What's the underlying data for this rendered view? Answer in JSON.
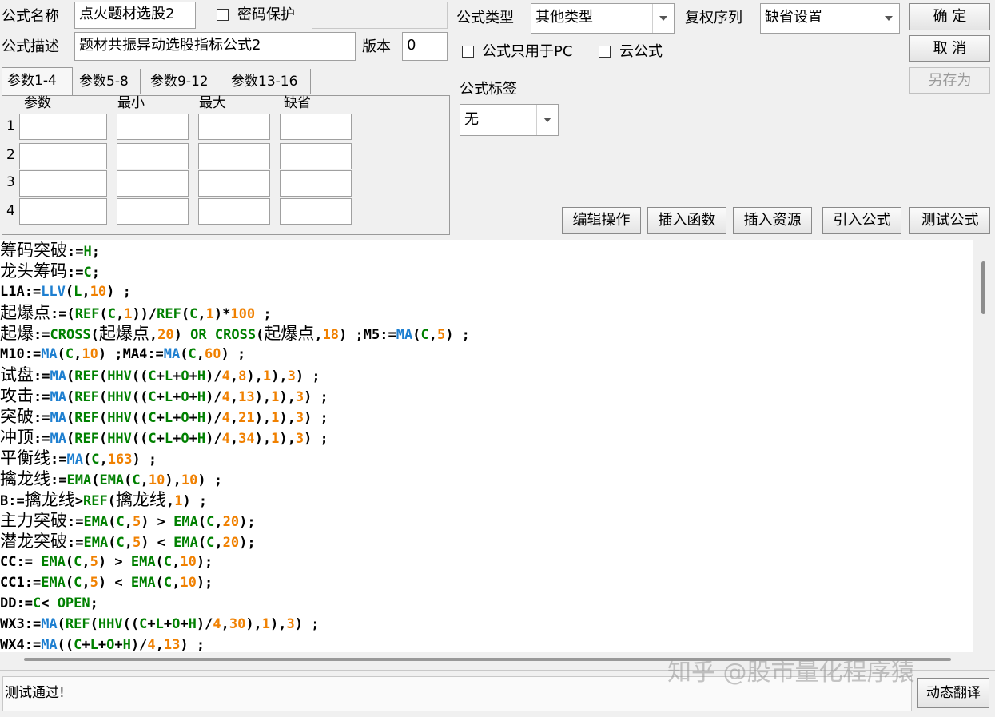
{
  "header": {
    "formula_name_label": "公式名称",
    "formula_name_value": "点火题材选股2",
    "password_label": "密码保护",
    "password_value": "",
    "formula_desc_label": "公式描述",
    "formula_desc_value": "题材共振异动选股指标公式2",
    "version_label": "版本",
    "version_value": "0",
    "type_label": "公式类型",
    "type_value": "其他类型",
    "rights_label": "复权序列",
    "rights_value": "缺省设置",
    "pc_only_label": "公式只用于PC",
    "cloud_label": "云公式",
    "tag_label": "公式标签",
    "tag_value": "无"
  },
  "buttons": {
    "ok": "确 定",
    "cancel": "取 消",
    "save_as": "另存为",
    "edit_ops": "编辑操作",
    "insert_func": "插入函数",
    "insert_res": "插入资源",
    "import_formula": "引入公式",
    "test_formula": "测试公式",
    "dyn_translate": "动态翻译"
  },
  "params": {
    "tabs": [
      "参数1-4",
      "参数5-8",
      "参数9-12",
      "参数13-16"
    ],
    "columns": [
      "参数",
      "最小",
      "最大",
      "缺省"
    ],
    "rows": [
      "1",
      "2",
      "3",
      "4"
    ]
  },
  "code_lines": [
    [
      [
        "筹码突破",
        "cn"
      ],
      [
        ":=",
        ""
      ],
      [
        "H",
        "g"
      ],
      [
        ";",
        ""
      ]
    ],
    [
      [
        "龙头筹码",
        "cn"
      ],
      [
        ":=",
        ""
      ],
      [
        "C",
        "g"
      ],
      [
        ";",
        ""
      ]
    ],
    [
      [
        "L1A:=",
        ""
      ],
      [
        "LLV",
        "b"
      ],
      [
        "(",
        ""
      ],
      [
        "L",
        "g"
      ],
      [
        ",",
        ""
      ],
      [
        "10",
        "o"
      ],
      [
        ") ;",
        ""
      ]
    ],
    [
      [
        "起爆点",
        "cn"
      ],
      [
        ":=(",
        ""
      ],
      [
        "REF",
        "g"
      ],
      [
        "(",
        ""
      ],
      [
        "C",
        "g"
      ],
      [
        ",",
        ""
      ],
      [
        "1",
        "o"
      ],
      [
        "))/",
        ""
      ],
      [
        "REF",
        "g"
      ],
      [
        "(",
        ""
      ],
      [
        "C",
        "g"
      ],
      [
        ",",
        ""
      ],
      [
        "1",
        "o"
      ],
      [
        ")*",
        ""
      ],
      [
        "100",
        "o"
      ],
      [
        " ;",
        ""
      ]
    ],
    [
      [
        "起爆",
        "cn"
      ],
      [
        ":=",
        ""
      ],
      [
        "CROSS",
        "g"
      ],
      [
        "(",
        ""
      ],
      [
        "起爆点",
        "cn"
      ],
      [
        ",",
        ""
      ],
      [
        "20",
        "o"
      ],
      [
        ") ",
        ""
      ],
      [
        "OR",
        "g"
      ],
      [
        " ",
        ""
      ],
      [
        "CROSS",
        "g"
      ],
      [
        "(",
        ""
      ],
      [
        "起爆点",
        "cn"
      ],
      [
        ",",
        ""
      ],
      [
        "18",
        "o"
      ],
      [
        ") ;M5:=",
        ""
      ],
      [
        "MA",
        "b"
      ],
      [
        "(",
        ""
      ],
      [
        "C",
        "g"
      ],
      [
        ",",
        ""
      ],
      [
        "5",
        "o"
      ],
      [
        ") ;",
        ""
      ]
    ],
    [
      [
        "M10:=",
        ""
      ],
      [
        "MA",
        "b"
      ],
      [
        "(",
        ""
      ],
      [
        "C",
        "g"
      ],
      [
        ",",
        ""
      ],
      [
        "10",
        "o"
      ],
      [
        ") ;MA4:=",
        ""
      ],
      [
        "MA",
        "b"
      ],
      [
        "(",
        ""
      ],
      [
        "C",
        "g"
      ],
      [
        ",",
        ""
      ],
      [
        "60",
        "o"
      ],
      [
        ") ;",
        ""
      ]
    ],
    [
      [
        "试盘",
        "cn"
      ],
      [
        ":=",
        ""
      ],
      [
        "MA",
        "b"
      ],
      [
        "(",
        ""
      ],
      [
        "REF",
        "g"
      ],
      [
        "(",
        ""
      ],
      [
        "HHV",
        "g"
      ],
      [
        "((",
        ""
      ],
      [
        "C",
        "g"
      ],
      [
        "+",
        ""
      ],
      [
        "L",
        "g"
      ],
      [
        "+",
        ""
      ],
      [
        "O",
        "g"
      ],
      [
        "+",
        ""
      ],
      [
        "H",
        "g"
      ],
      [
        ")/",
        ""
      ],
      [
        "4",
        "o"
      ],
      [
        ",",
        ""
      ],
      [
        "8",
        "o"
      ],
      [
        "),",
        ""
      ],
      [
        "1",
        "o"
      ],
      [
        "),",
        ""
      ],
      [
        "3",
        "o"
      ],
      [
        ") ;",
        ""
      ]
    ],
    [
      [
        "攻击",
        "cn"
      ],
      [
        ":=",
        ""
      ],
      [
        "MA",
        "b"
      ],
      [
        "(",
        ""
      ],
      [
        "REF",
        "g"
      ],
      [
        "(",
        ""
      ],
      [
        "HHV",
        "g"
      ],
      [
        "((",
        ""
      ],
      [
        "C",
        "g"
      ],
      [
        "+",
        ""
      ],
      [
        "L",
        "g"
      ],
      [
        "+",
        ""
      ],
      [
        "O",
        "g"
      ],
      [
        "+",
        ""
      ],
      [
        "H",
        "g"
      ],
      [
        ")/",
        ""
      ],
      [
        "4",
        "o"
      ],
      [
        ",",
        ""
      ],
      [
        "13",
        "o"
      ],
      [
        "),",
        ""
      ],
      [
        "1",
        "o"
      ],
      [
        "),",
        ""
      ],
      [
        "3",
        "o"
      ],
      [
        ") ;",
        ""
      ]
    ],
    [
      [
        "突破",
        "cn"
      ],
      [
        ":=",
        ""
      ],
      [
        "MA",
        "b"
      ],
      [
        "(",
        ""
      ],
      [
        "REF",
        "g"
      ],
      [
        "(",
        ""
      ],
      [
        "HHV",
        "g"
      ],
      [
        "((",
        ""
      ],
      [
        "C",
        "g"
      ],
      [
        "+",
        ""
      ],
      [
        "L",
        "g"
      ],
      [
        "+",
        ""
      ],
      [
        "O",
        "g"
      ],
      [
        "+",
        ""
      ],
      [
        "H",
        "g"
      ],
      [
        ")/",
        ""
      ],
      [
        "4",
        "o"
      ],
      [
        ",",
        ""
      ],
      [
        "21",
        "o"
      ],
      [
        "),",
        ""
      ],
      [
        "1",
        "o"
      ],
      [
        "),",
        ""
      ],
      [
        "3",
        "o"
      ],
      [
        ") ;",
        ""
      ]
    ],
    [
      [
        "冲顶",
        "cn"
      ],
      [
        ":=",
        ""
      ],
      [
        "MA",
        "b"
      ],
      [
        "(",
        ""
      ],
      [
        "REF",
        "g"
      ],
      [
        "(",
        ""
      ],
      [
        "HHV",
        "g"
      ],
      [
        "((",
        ""
      ],
      [
        "C",
        "g"
      ],
      [
        "+",
        ""
      ],
      [
        "L",
        "g"
      ],
      [
        "+",
        ""
      ],
      [
        "O",
        "g"
      ],
      [
        "+",
        ""
      ],
      [
        "H",
        "g"
      ],
      [
        ")/",
        ""
      ],
      [
        "4",
        "o"
      ],
      [
        ",",
        ""
      ],
      [
        "34",
        "o"
      ],
      [
        "),",
        ""
      ],
      [
        "1",
        "o"
      ],
      [
        "),",
        ""
      ],
      [
        "3",
        "o"
      ],
      [
        ") ;",
        ""
      ]
    ],
    [
      [
        "平衡线",
        "cn"
      ],
      [
        ":=",
        ""
      ],
      [
        "MA",
        "b"
      ],
      [
        "(",
        ""
      ],
      [
        "C",
        "g"
      ],
      [
        ",",
        ""
      ],
      [
        "163",
        "o"
      ],
      [
        ") ;",
        ""
      ]
    ],
    [
      [
        "擒龙线",
        "cn"
      ],
      [
        ":=",
        ""
      ],
      [
        "EMA",
        "g"
      ],
      [
        "(",
        ""
      ],
      [
        "EMA",
        "g"
      ],
      [
        "(",
        ""
      ],
      [
        "C",
        "g"
      ],
      [
        ",",
        ""
      ],
      [
        "10",
        "o"
      ],
      [
        "),",
        ""
      ],
      [
        "10",
        "o"
      ],
      [
        ") ;",
        ""
      ]
    ],
    [
      [
        "B:=",
        ""
      ],
      [
        "擒龙线",
        "cn"
      ],
      [
        ">",
        ""
      ],
      [
        "REF",
        "g"
      ],
      [
        "(",
        ""
      ],
      [
        "擒龙线",
        "cn"
      ],
      [
        ",",
        ""
      ],
      [
        "1",
        "o"
      ],
      [
        ") ;",
        ""
      ]
    ],
    [
      [
        "主力突破",
        "cn"
      ],
      [
        ":=",
        ""
      ],
      [
        "EMA",
        "g"
      ],
      [
        "(",
        ""
      ],
      [
        "C",
        "g"
      ],
      [
        ",",
        ""
      ],
      [
        "5",
        "o"
      ],
      [
        ") > ",
        ""
      ],
      [
        "EMA",
        "g"
      ],
      [
        "(",
        ""
      ],
      [
        "C",
        "g"
      ],
      [
        ",",
        ""
      ],
      [
        "20",
        "o"
      ],
      [
        ");",
        ""
      ]
    ],
    [
      [
        "潜龙突破",
        "cn"
      ],
      [
        ":=",
        ""
      ],
      [
        "EMA",
        "g"
      ],
      [
        "(",
        ""
      ],
      [
        "C",
        "g"
      ],
      [
        ",",
        ""
      ],
      [
        "5",
        "o"
      ],
      [
        ") < ",
        ""
      ],
      [
        "EMA",
        "g"
      ],
      [
        "(",
        ""
      ],
      [
        "C",
        "g"
      ],
      [
        ",",
        ""
      ],
      [
        "20",
        "o"
      ],
      [
        ");",
        ""
      ]
    ],
    [
      [
        "CC:= ",
        ""
      ],
      [
        "EMA",
        "g"
      ],
      [
        "(",
        ""
      ],
      [
        "C",
        "g"
      ],
      [
        ",",
        ""
      ],
      [
        "5",
        "o"
      ],
      [
        ") > ",
        ""
      ],
      [
        "EMA",
        "g"
      ],
      [
        "(",
        ""
      ],
      [
        "C",
        "g"
      ],
      [
        ",",
        ""
      ],
      [
        "10",
        "o"
      ],
      [
        ");",
        ""
      ]
    ],
    [
      [
        "CC1:=",
        ""
      ],
      [
        "EMA",
        "g"
      ],
      [
        "(",
        ""
      ],
      [
        "C",
        "g"
      ],
      [
        ",",
        ""
      ],
      [
        "5",
        "o"
      ],
      [
        ") < ",
        ""
      ],
      [
        "EMA",
        "g"
      ],
      [
        "(",
        ""
      ],
      [
        "C",
        "g"
      ],
      [
        ",",
        ""
      ],
      [
        "10",
        "o"
      ],
      [
        ");",
        ""
      ]
    ],
    [
      [
        "DD:=",
        ""
      ],
      [
        "C",
        "g"
      ],
      [
        "< ",
        ""
      ],
      [
        "OPEN",
        "g"
      ],
      [
        ";",
        ""
      ]
    ],
    [
      [
        "WX3:=",
        ""
      ],
      [
        "MA",
        "b"
      ],
      [
        "(",
        ""
      ],
      [
        "REF",
        "g"
      ],
      [
        "(",
        ""
      ],
      [
        "HHV",
        "g"
      ],
      [
        "((",
        ""
      ],
      [
        "C",
        "g"
      ],
      [
        "+",
        ""
      ],
      [
        "L",
        "g"
      ],
      [
        "+",
        ""
      ],
      [
        "O",
        "g"
      ],
      [
        "+",
        ""
      ],
      [
        "H",
        "g"
      ],
      [
        ")/",
        ""
      ],
      [
        "4",
        "o"
      ],
      [
        ",",
        ""
      ],
      [
        "30",
        "o"
      ],
      [
        "),",
        ""
      ],
      [
        "1",
        "o"
      ],
      [
        "),",
        ""
      ],
      [
        "3",
        "o"
      ],
      [
        ") ;",
        ""
      ]
    ],
    [
      [
        "WX4:=",
        ""
      ],
      [
        "MA",
        "b"
      ],
      [
        "((",
        ""
      ],
      [
        "C",
        "g"
      ],
      [
        "+",
        ""
      ],
      [
        "L",
        "g"
      ],
      [
        "+",
        ""
      ],
      [
        "O",
        "g"
      ],
      [
        "+",
        ""
      ],
      [
        "H",
        "g"
      ],
      [
        ")/",
        ""
      ],
      [
        "4",
        "o"
      ],
      [
        ",",
        ""
      ],
      [
        "13",
        "o"
      ],
      [
        ") ;",
        ""
      ]
    ]
  ],
  "status": {
    "message": "测试通过!",
    "watermark": "知乎 @股市量化程序猿"
  }
}
